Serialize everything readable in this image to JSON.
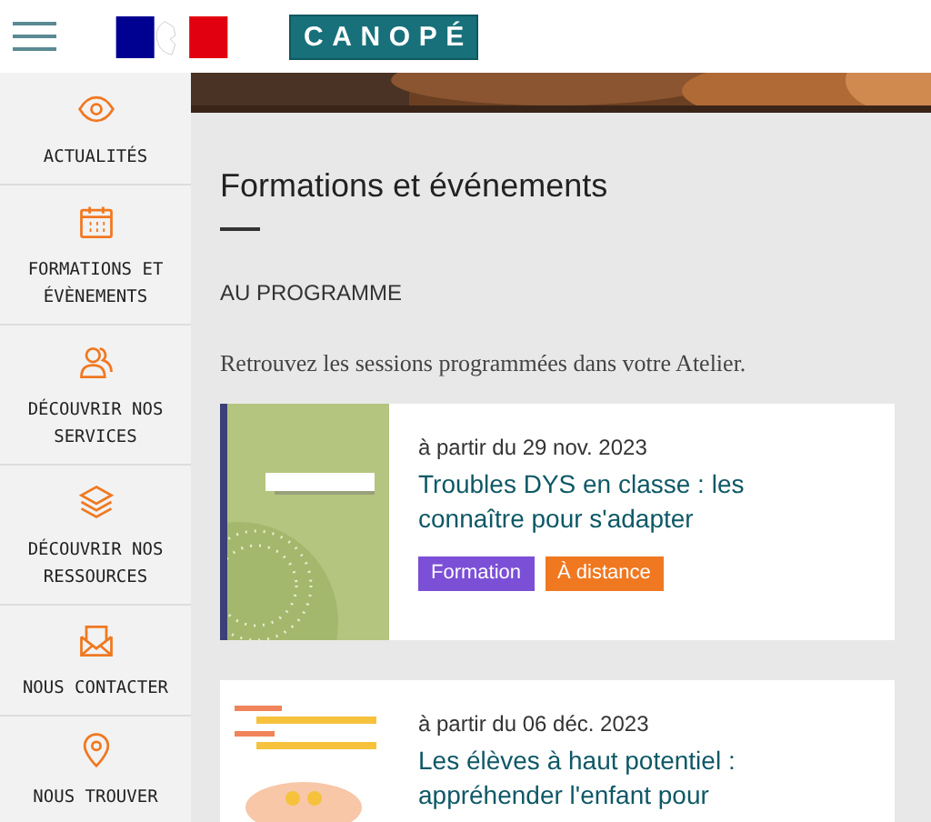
{
  "header": {
    "logo_text": "CANOPÉ"
  },
  "sidebar": {
    "items": [
      {
        "label": "ACTUALITÉS"
      },
      {
        "label": "FORMATIONS ET ÉVÈNEMENTS"
      },
      {
        "label": "DÉCOUVRIR NOS SERVICES"
      },
      {
        "label": "DÉCOUVRIR NOS RESSOURCES"
      },
      {
        "label": "NOUS CONTACTER"
      },
      {
        "label": "NOUS TROUVER"
      }
    ]
  },
  "main": {
    "title": "Formations et événements",
    "section": "AU PROGRAMME",
    "intro": "Retrouvez les sessions programmées dans votre Atelier.",
    "events": [
      {
        "date": "à partir du 29 nov. 2023",
        "title": "Troubles DYS en classe : les connaître pour s'adapter",
        "tags": [
          {
            "label": "Formation",
            "color": "#7b4fd6"
          },
          {
            "label": "À distance",
            "color": "#f07820"
          }
        ]
      },
      {
        "date": "à partir du 06 déc. 2023",
        "title": "Les élèves à haut potentiel : appréhender l'enfant pour"
      }
    ]
  }
}
